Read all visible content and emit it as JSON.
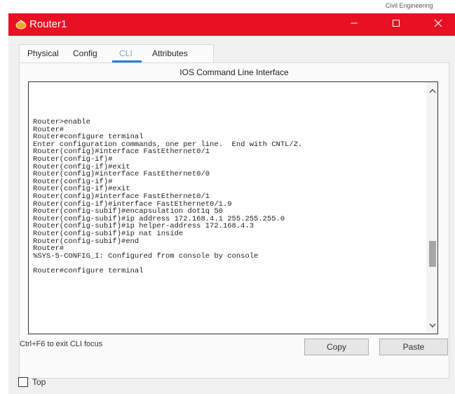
{
  "watermark": "Civil Engineering",
  "window": {
    "title": "Router1",
    "icon": "router-icon",
    "controls": {
      "minimize": "minimize-icon",
      "maximize": "maximize-icon",
      "close": "close-icon"
    }
  },
  "tabs": {
    "physical": "Physical",
    "config": "Config",
    "cli": "CLI",
    "attributes": "Attributes",
    "active": "CLI"
  },
  "panel": {
    "title": "IOS Command Line Interface"
  },
  "terminal": {
    "lines": [
      "Router>enable",
      "Router#",
      "Router#configure terminal",
      "Enter configuration commands, one per line.  End with CNTL/Z.",
      "Router(config)#interface FastEthernet0/1",
      "Router(config-if)#",
      "Router(config-if)#exit",
      "Router(config)#interface FastEthernet0/0",
      "Router(config-if)#",
      "Router(config-if)#exit",
      "Router(config)#interface FastEthernet0/1",
      "Router(config-if)#interface FastEthernet0/1.9",
      "Router(config-subif)#encapsulation dot1q 50",
      "Router(config-subif)#ip address 172.168.4.1 255.255.255.0",
      "Router(config-subif)#ip helper-address 172.168.4.3",
      "Router(config-subif)#ip nat inside",
      "Router(config-subif)#end",
      "Router#",
      "%SYS-5-CONFIG_I: Configured from console by console",
      "",
      "Router#configure terminal"
    ]
  },
  "footer": {
    "hint": "Ctrl+F6 to exit CLI focus",
    "copy_label": "Copy",
    "paste_label": "Paste"
  },
  "top_checkbox": {
    "label": "Top",
    "checked": false
  },
  "colors": {
    "titlebar": "#e81123",
    "tab_active_underline": "#2a7fd4"
  }
}
